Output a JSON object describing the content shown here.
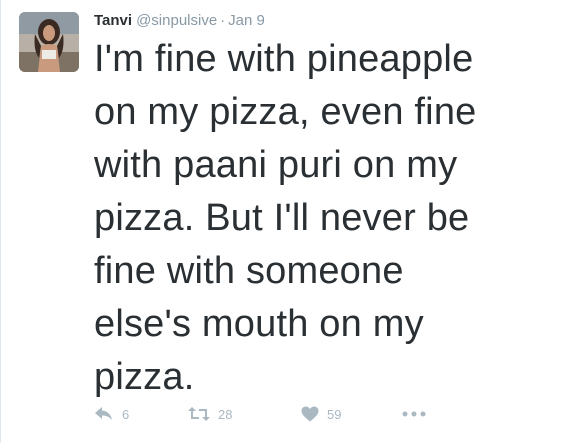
{
  "tweet": {
    "display_name": "Tanvi",
    "handle": "@sinpulsive",
    "separator": "·",
    "timestamp": "Jan 9",
    "text_lines": [
      "I'm fine with pineapple",
      "on my pizza, even fine",
      "with paani puri on my",
      "pizza. But I'll never be",
      "fine with someone",
      "else's mouth on my",
      "pizza."
    ],
    "actions": {
      "reply_count": "6",
      "retweet_count": "28",
      "like_count": "59"
    }
  },
  "icons": {
    "reply": "reply-icon",
    "retweet": "retweet-icon",
    "like": "heart-icon",
    "more": "more-icon"
  },
  "colors": {
    "text": "#292f33",
    "muted": "#8899a6",
    "icon": "#aab8c2",
    "border": "#e1e8ed"
  }
}
